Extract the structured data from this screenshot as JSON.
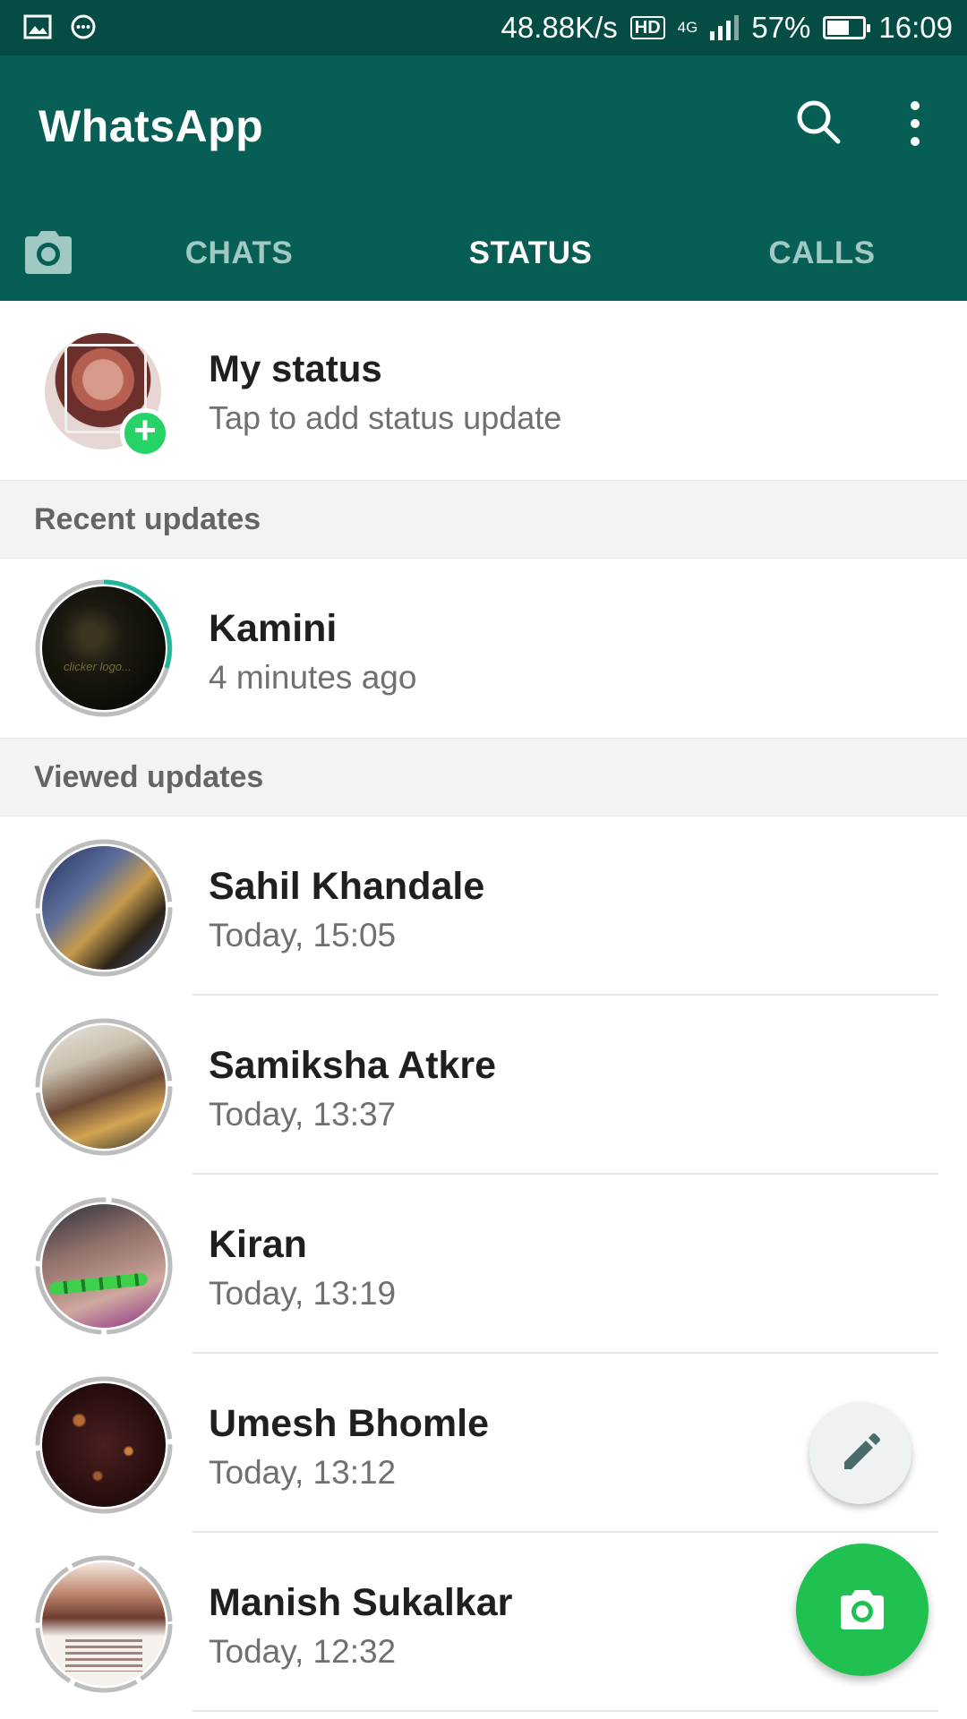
{
  "status_bar": {
    "net_speed": "48.88K/s",
    "hd": "HD",
    "network": "4G",
    "battery": "57%",
    "battery_level": 0.57,
    "time": "16:09"
  },
  "app_bar": {
    "title": "WhatsApp",
    "tabs": [
      {
        "label": "CHATS",
        "active": false
      },
      {
        "label": "STATUS",
        "active": true
      },
      {
        "label": "CALLS",
        "active": false
      }
    ]
  },
  "my_status": {
    "name": "My status",
    "subtitle": "Tap to add status update"
  },
  "recent": {
    "header": "Recent updates",
    "items": [
      {
        "name": "Kamini",
        "time": "4 minutes ago"
      }
    ]
  },
  "viewed": {
    "header": "Viewed updates",
    "items": [
      {
        "name": "Sahil Khandale",
        "time": "Today, 15:05"
      },
      {
        "name": "Samiksha Atkre",
        "time": "Today, 13:37"
      },
      {
        "name": "Kiran",
        "time": "Today, 13:19"
      },
      {
        "name": "Umesh Bhomle",
        "time": "Today, 13:12"
      },
      {
        "name": "Manish Sukalkar",
        "time": "Today, 12:32"
      }
    ]
  },
  "colors": {
    "header": "#075e54",
    "status_bar": "#054d44",
    "accent_green": "#25d366",
    "unseen_ring": "#1fb59b",
    "seen_ring": "#bdbdbd"
  },
  "icons": {
    "search": "search-icon",
    "more": "more-vert-icon",
    "camera_tab": "camera-icon",
    "fab_small": "pencil-icon",
    "fab_large": "camera-icon"
  }
}
